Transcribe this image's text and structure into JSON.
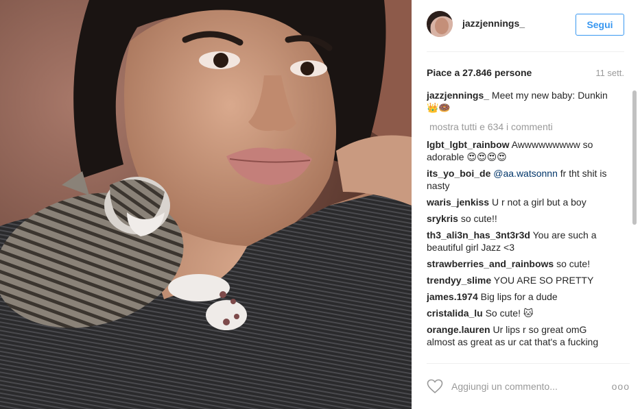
{
  "post": {
    "username": "jazzjennings_",
    "follow_label": "Segui",
    "likes": "Piace a 27.846 persone",
    "time": "11 sett.",
    "load_more": "mostra tutti e 634 i commenti",
    "add_comment_placeholder": "Aggiungi un commento...",
    "more_label": "ooo"
  },
  "comments": [
    {
      "user": "jazzjennings_",
      "text": " Meet my new baby: Dunkin👑🍩"
    },
    {
      "user": "lgbt_lgbt_rainbow",
      "text": " Awwwwwwwww so adorable 😍😍😍😍"
    },
    {
      "user": "its_yo_boi_de",
      "mention": "@aa.watsonnn",
      "text": " fr tht shit is nasty"
    },
    {
      "user": "waris_jenkiss",
      "text": " U r not a girl but a boy"
    },
    {
      "user": "srykris",
      "text": " so cute!!"
    },
    {
      "user": "th3_ali3n_has_3nt3r3d",
      "text": " You are such a beautiful girl Jazz <3"
    },
    {
      "user": "strawberries_and_rainbows",
      "text": " so cute!"
    },
    {
      "user": "trendyy_slime",
      "text": " YOU ARE SO PRETTY"
    },
    {
      "user": "james.1974",
      "text": " Big lips for a dude"
    },
    {
      "user": "cristalida_lu",
      "text": " So cute! 🐱"
    },
    {
      "user": "orange.lauren",
      "text": " Ur lips r so great omG almost as great as ur cat that's a fucking"
    }
  ],
  "colors": {
    "accent": "#3897f0",
    "muted": "#999999",
    "text": "#262626"
  }
}
